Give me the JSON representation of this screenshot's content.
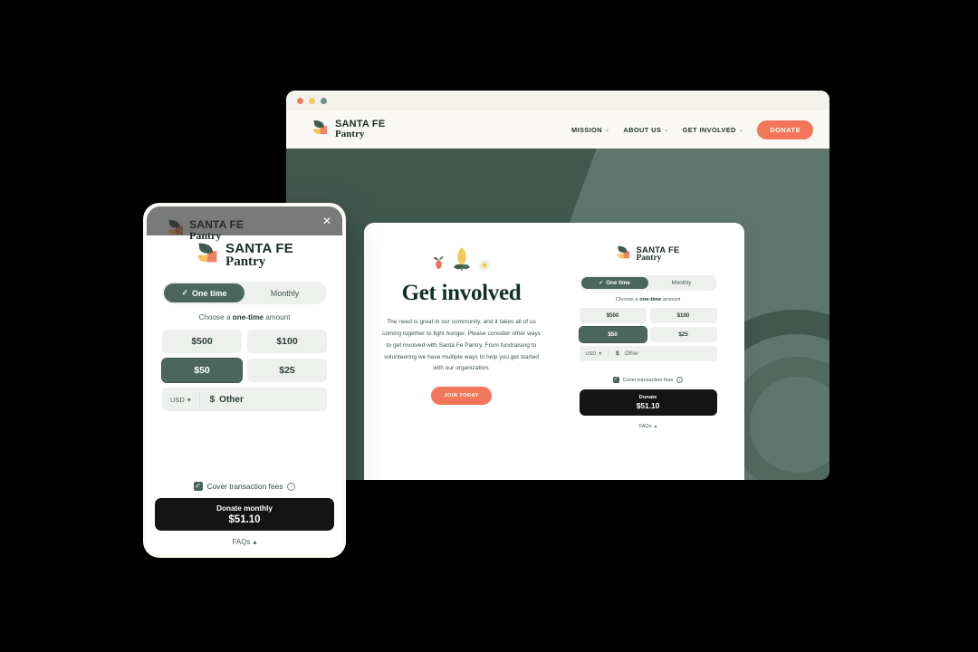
{
  "browser": {
    "traffic_lights": [
      "red",
      "yellow",
      "green"
    ],
    "nav": {
      "items": [
        {
          "label": "MISSION",
          "caret": "⌄"
        },
        {
          "label": "ABOUT US",
          "caret": "⌄"
        },
        {
          "label": "GET INVOLVED",
          "caret": "⌄"
        }
      ],
      "donate_label": "DONATE"
    }
  },
  "brand": {
    "line1": "SANTA FE",
    "line2": "Pantry",
    "colors": {
      "leaf_dark": "#3f5a4e",
      "leaf_yellow": "#f2c85c",
      "leaf_coral": "#ef8365",
      "bg_dark_green": "#41584f",
      "bg_light_green": "#5f766e",
      "accent_coral": "#f2775a",
      "selected_green": "#4b665c",
      "cta_black": "#141414"
    }
  },
  "hero": {
    "icons": [
      "radish-icon",
      "corn-icon",
      "egg-icon"
    ],
    "heading": "Get involved",
    "body": "The need is great in our community, and it takes all of us coming together to fight hunger. Please consider other ways to get involved with Santa Fe Pantry. From fundraising to volunteering we have multiple ways to help you get started with our organization.",
    "join_label": "JOIN TODAY"
  },
  "widget_desktop": {
    "toggle": {
      "options": [
        {
          "label": "One time",
          "active": true,
          "check": "✓"
        },
        {
          "label": "Monthly",
          "active": false
        }
      ]
    },
    "choose_prefix": "Choose a ",
    "choose_bold": "one-time",
    "choose_suffix": " amount",
    "amounts": [
      {
        "label": "$500",
        "selected": false
      },
      {
        "label": "$100",
        "selected": false
      },
      {
        "label": "$50",
        "selected": true
      },
      {
        "label": "$25",
        "selected": false
      }
    ],
    "currency": "USD",
    "currency_caret": "▾",
    "other_symbol": "$",
    "other_label": "Other",
    "fee_label": "Cover transaction fees",
    "fee_checked": true,
    "info_glyph": "i",
    "cta_line1": "Donate",
    "cta_line2": "$51.10",
    "faqs_label": "FAQs",
    "faqs_caret": "▴"
  },
  "widget_mobile": {
    "close_glyph": "✕",
    "toggle": {
      "options": [
        {
          "label": "One time",
          "active": true,
          "check": "✓"
        },
        {
          "label": "Monthly",
          "active": false
        }
      ]
    },
    "choose_prefix": "Choose a ",
    "choose_bold": "one-time",
    "choose_suffix": " amount",
    "amounts": [
      {
        "label": "$500",
        "selected": false
      },
      {
        "label": "$100",
        "selected": false
      },
      {
        "label": "$50",
        "selected": true
      },
      {
        "label": "$25",
        "selected": false
      }
    ],
    "currency": "USD",
    "currency_caret": "▾",
    "other_symbol": "$",
    "other_label": "Other",
    "fee_label": "Cover transaction fees",
    "fee_checked": true,
    "info_glyph": "i",
    "cta_line1": "Donate monthly",
    "cta_line2": "$51.10",
    "faqs_label": "FAQs",
    "faqs_caret": "▴"
  }
}
